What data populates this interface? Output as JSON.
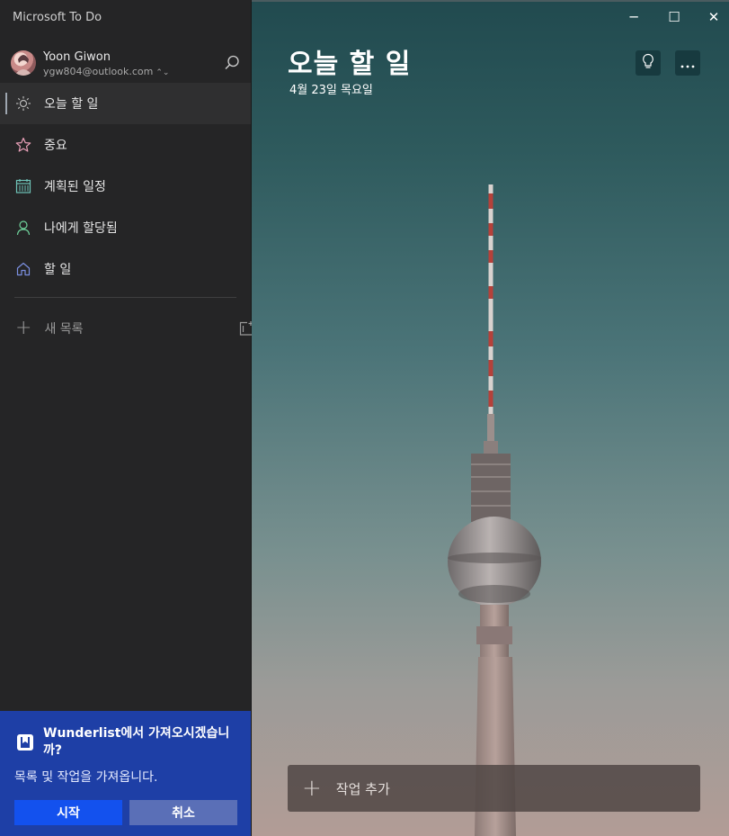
{
  "app": {
    "title": "Microsoft To Do"
  },
  "profile": {
    "name": "Yoon Giwon",
    "email": "ygw804@outlook.com"
  },
  "nav": {
    "items": [
      {
        "label": "오늘 할 일",
        "icon": "sun-icon",
        "color": "#b9b9b9",
        "active": true
      },
      {
        "label": "중요",
        "icon": "star-icon",
        "color": "#e8a0b8",
        "active": false
      },
      {
        "label": "계획된 일정",
        "icon": "calendar-icon",
        "color": "#6fc4b8",
        "active": false
      },
      {
        "label": "나에게 할당됨",
        "icon": "person-icon",
        "color": "#6fd19b",
        "active": false
      },
      {
        "label": "할 일",
        "icon": "home-icon",
        "color": "#7b8fe0",
        "active": false
      }
    ]
  },
  "new_list": {
    "label": "새 목록"
  },
  "import_prompt": {
    "title": "Wunderlist에서 가져오시겠습니까?",
    "description": "목록 및 작업을 가져옵니다.",
    "start_label": "시작",
    "cancel_label": "취소",
    "bg_color": "#1e3fa6",
    "start_color": "#1351ee"
  },
  "window_controls": {
    "minimize": "─",
    "maximize": "☐",
    "close": "✕"
  },
  "main": {
    "title": "오늘 할 일",
    "date": "4월 23일 목요일",
    "add_task_label": "작업 추가"
  }
}
